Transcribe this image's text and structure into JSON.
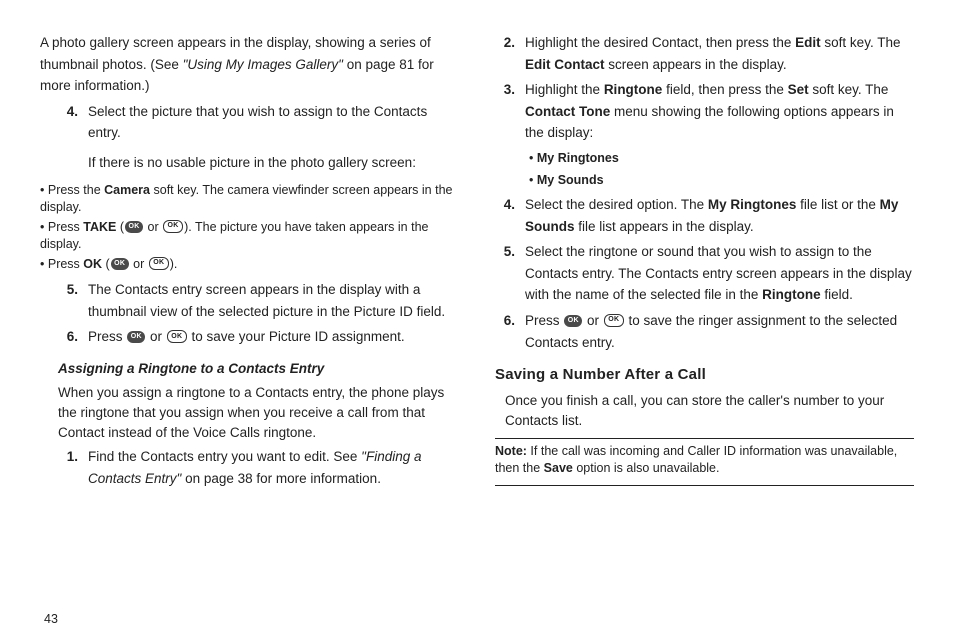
{
  "left": {
    "intro_gallery": {
      "t1": "A photo gallery screen appears in the display, showing a series of thumbnail photos. (See ",
      "ref": "\"Using My Images Gallery\"",
      "t2": " on page 81 for more information.)"
    },
    "step4": {
      "num": "4.",
      "body": "Select the picture that you wish to assign to the Contacts entry.",
      "note": "If there is no usable picture in the photo gallery screen:"
    },
    "bullets": {
      "b1a": "Press the ",
      "b1_bold": "Camera",
      "b1b": " soft key. The camera viewfinder screen appears in the display.",
      "b2a": "Press ",
      "b2_bold": "TAKE",
      "b2b": " (",
      "b2c": " or ",
      "b2d": "). The picture you have taken appears in the display.",
      "b3a": "Press ",
      "b3_bold": "OK",
      "b3b": " (",
      "b3c": " or ",
      "b3d": ")."
    },
    "step5": {
      "num": "5.",
      "body": "The Contacts entry screen appears in the display with a thumbnail view of the selected picture in the Picture ID field."
    },
    "step6": {
      "num": "6.",
      "a": "Press ",
      "b": " or ",
      "c": " to save your Picture ID assignment."
    },
    "h3": "Assigning a Ringtone to a Contacts Entry",
    "ring_intro": "When you assign a ringtone to a Contacts entry, the phone plays the ringtone that you assign when you receive a call from that Contact instead of the Voice Calls ringtone.",
    "rstep1": {
      "num": "1.",
      "a": "Find the Contacts entry you want to edit. See ",
      "ref": "\"Finding a Contacts Entry\"",
      "b": " on page 38 for more information."
    },
    "pagenum": "43"
  },
  "right": {
    "rstep2": {
      "num": "2.",
      "a": "Highlight the desired Contact, then press the ",
      "b1": "Edit",
      "b": " soft key. The ",
      "b2": "Edit Contact",
      "c": " screen appears in the display."
    },
    "rstep3": {
      "num": "3.",
      "a": "Highlight the ",
      "b1": "Ringtone",
      "b": " field, then press the ",
      "b2": "Set",
      "c": " soft key. The ",
      "b3": "Contact Tone",
      "d": " menu showing the following options appears in the display:"
    },
    "opt1": "My Ringtones",
    "opt2": "My Sounds",
    "rstep4": {
      "num": "4.",
      "a": "Select the desired option. The ",
      "b1": "My Ringtones",
      "b": " file list or the ",
      "b2": "My Sounds",
      "c": " file list appears in the display."
    },
    "rstep5": {
      "num": "5.",
      "a": "Select the ringtone or sound that you wish to assign to the Contacts entry. The Contacts entry screen appears in the display with the name of the selected file in the ",
      "b1": "Ringtone",
      "b": " field."
    },
    "rstep6": {
      "num": "6.",
      "a": "Press ",
      "b": " or ",
      "c": " to save the ringer assignment to the selected Contacts entry."
    },
    "h2": "Saving a Number After a Call",
    "save_intro": "Once you finish a call, you can store the caller's number to your Contacts list.",
    "note_label": "Note:",
    "note_a": " If the call was incoming and Caller ID information was unavailable, then the ",
    "note_b": "Save",
    "note_c": " option is also unavailable."
  }
}
